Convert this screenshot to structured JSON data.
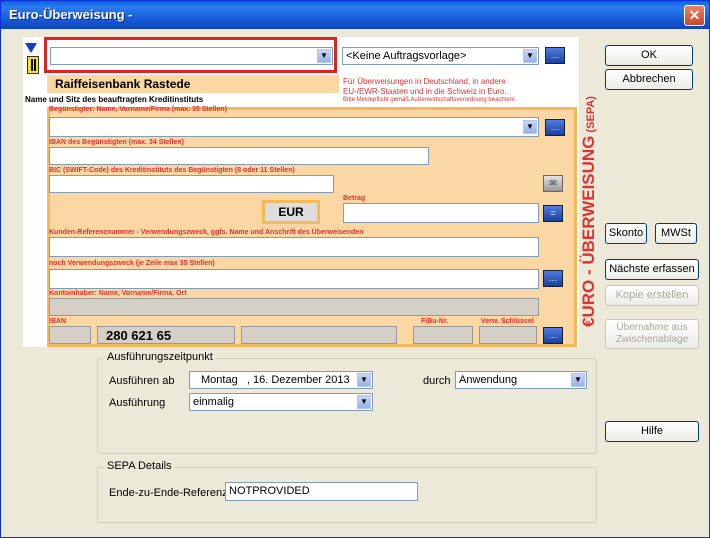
{
  "window": {
    "title": "Euro-Überweisung -",
    "close": "✕"
  },
  "template_select": {
    "value": "<Keine Auftragsvorlage>"
  },
  "bank": {
    "name": "Raiffeisenbank Rastede",
    "caption": "Name und Sitz des beauftragten Kreditinstituts"
  },
  "notice": {
    "line1": "Für Überweisungen in Deutschland, in andere",
    "line2": "EU-/EWR-Staaten und in die Schweiz in Euro.",
    "line3": "Bitte Meldepflicht gemäß Außenwirtschaftsverordnung beachten!"
  },
  "labels": {
    "beneficiary": "Begünstigter: Name, Vorname/Firma (max. 35 Stellen)",
    "iban_beneficiary": "IBAN des Begünstigten (max. 34 Stellen)",
    "bic": "BIC (SWIFT-Code) des Kreditinstituts des Begünstigten (8 oder 11 Stellen)",
    "amount": "Betrag",
    "reference": "Kunden-Referenznummer - Verwendungszweck, ggfs. Name und Anschrift des Überweisenden",
    "reference2": "noch Verwendungszweck (je Zeile max 35 Stellen)",
    "holder": "Kontoinhaber: Name, Vorname/Firma, Ort",
    "iban": "IBAN",
    "fibu": "FiBu-Nr.",
    "key": "Verw. Schlüssel"
  },
  "currency": "EUR",
  "account_number": "280 621 65",
  "vertical_text": {
    "main": "€URO - ÜBERWEISUNG",
    "sepa": "(SEPA)"
  },
  "buttons": {
    "ok": "OK",
    "cancel": "Abbrechen",
    "skonto": "Skonto",
    "mwst": "MWSt",
    "next": "Nächste erfassen",
    "copy": "Kopie erstellen",
    "paste": "Übernahme aus Zwischenablage",
    "help": "Hilfe"
  },
  "execution": {
    "group_title": "Ausführungszeitpunkt",
    "execute_from_label": "Ausführen ab",
    "execute_from_value": "Montag   , 16. Dezember 2013",
    "execution_label": "Ausführung",
    "execution_value": "einmalig",
    "by_label": "durch",
    "by_value": "Anwendung"
  },
  "sepa": {
    "group_title": "SEPA Details",
    "e2e_label": "Ende-zu-Ende-Referenz",
    "e2e_value": "NOTPROVIDED"
  },
  "colors": {
    "accent_red": "#d33",
    "form_orange": "#fbd7a3",
    "titlebar_blue": "#0a5fdd"
  }
}
